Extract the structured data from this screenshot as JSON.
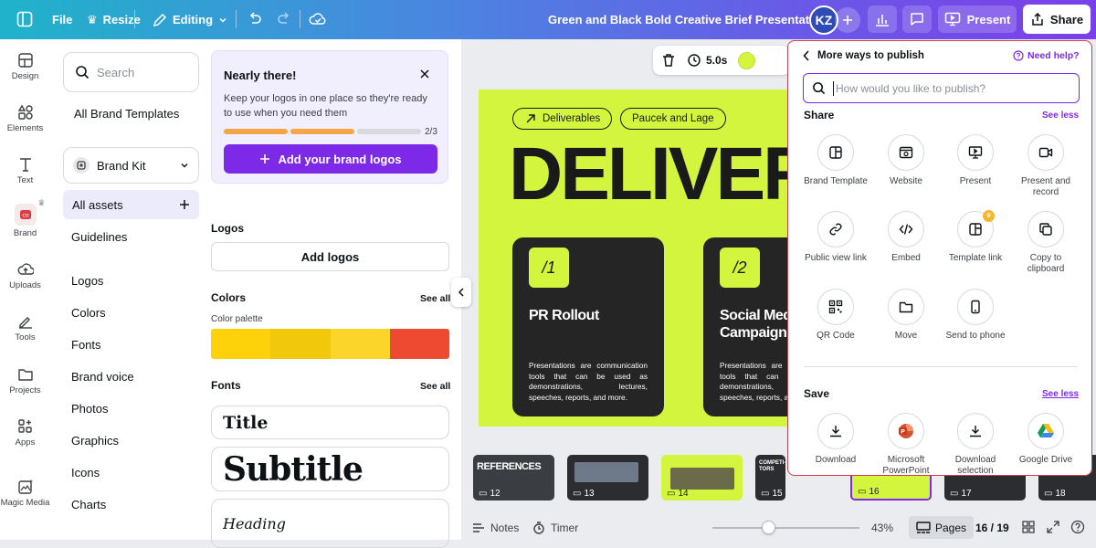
{
  "topbar": {
    "file": "File",
    "resize": "Resize",
    "editing": "Editing",
    "title": "Green and Black Bold Creative Brief Presentation",
    "avatar_initials": "KZ",
    "present": "Present",
    "share": "Share"
  },
  "rail": [
    {
      "label": "Design",
      "icon": "layout-icon"
    },
    {
      "label": "Elements",
      "icon": "shapes-icon"
    },
    {
      "label": "Text",
      "icon": "text-icon"
    },
    {
      "label": "Brand",
      "icon": "brand-icon"
    },
    {
      "label": "Uploads",
      "icon": "cloud-upload-icon"
    },
    {
      "label": "Tools",
      "icon": "pen-icon"
    },
    {
      "label": "Projects",
      "icon": "folder-icon"
    },
    {
      "label": "Apps",
      "icon": "apps-icon"
    },
    {
      "label": "Magic Media",
      "icon": "magic-media-icon"
    }
  ],
  "panel": {
    "search_placeholder": "Search",
    "all_brand_templates": "All Brand Templates",
    "brand_kit": "Brand Kit",
    "all_assets": "All assets",
    "guidelines": "Guidelines",
    "nav": [
      "Logos",
      "Colors",
      "Fonts",
      "Brand voice",
      "Photos",
      "Graphics",
      "Icons",
      "Charts"
    ],
    "nudge": {
      "title": "Nearly there!",
      "body": "Keep your logos in one place so they're ready to use when you need them",
      "progress_text": "2/3",
      "progress_completed": 2,
      "progress_total": 3,
      "button": "Add your brand logos"
    },
    "logos_title": "Logos",
    "add_logos": "Add logos",
    "colors_title": "Colors",
    "colors_see_all": "See all",
    "color_palette_label": "Color palette",
    "palette": [
      "#fdd20a",
      "#f2c80c",
      "#fbd52a",
      "#ee4a32"
    ],
    "fonts_title": "Fonts",
    "fonts_see_all": "See all",
    "font_samples": [
      "Title",
      "Subtitle",
      "Heading"
    ]
  },
  "canvas": {
    "duration": "5.0s",
    "color_swatch": "#d4f53d",
    "pills": [
      "Deliverables",
      "Paucek and Lage"
    ],
    "headline": "DELIVER",
    "cards": [
      {
        "num": "/1",
        "title": "PR Rollout",
        "body": "Presentations are communication tools that can be used as demonstrations, lectures, speeches, reports, and more."
      },
      {
        "num": "/2",
        "title": "Social Med Campaign",
        "body": "Presentations are communication tools that can be used as demonstrations, lectures, speeches, reports, and more."
      }
    ]
  },
  "pages": [
    {
      "num": "12",
      "caption": "REFERENCES"
    },
    {
      "num": "13",
      "caption": ""
    },
    {
      "num": "14",
      "caption": ""
    },
    {
      "num": "15",
      "caption": "COMPETI-TORS"
    },
    {
      "num": "16",
      "caption": ""
    },
    {
      "num": "17",
      "caption": ""
    },
    {
      "num": "18",
      "caption": ""
    }
  ],
  "bottombar": {
    "notes": "Notes",
    "timer": "Timer",
    "zoom": "43%",
    "zoom_level": 0.43,
    "pages": "Pages",
    "page_count": "16 / 19"
  },
  "publish": {
    "title": "More ways to publish",
    "need_help": "Need help?",
    "search_placeholder": "How would you like to publish?",
    "share_title": "Share",
    "share_see_less": "See less",
    "share_items": [
      {
        "label": "Brand Template",
        "icon": "brand-template-icon"
      },
      {
        "label": "Website",
        "icon": "website-icon"
      },
      {
        "label": "Present",
        "icon": "present-icon"
      },
      {
        "label": "Present and record",
        "icon": "record-icon"
      },
      {
        "label": "Public view link",
        "icon": "link-icon"
      },
      {
        "label": "Embed",
        "icon": "embed-icon"
      },
      {
        "label": "Template link",
        "icon": "template-link-icon"
      },
      {
        "label": "Copy to clipboard",
        "icon": "copy-icon"
      },
      {
        "label": "QR Code",
        "icon": "qr-code-icon"
      },
      {
        "label": "Move",
        "icon": "folder-move-icon"
      },
      {
        "label": "Send to phone",
        "icon": "phone-icon"
      }
    ],
    "save_title": "Save",
    "save_see_less": "See less",
    "save_items": [
      {
        "label": "Download",
        "icon": "download-icon"
      },
      {
        "label": "Microsoft PowerPoint",
        "icon": "powerpoint-icon"
      },
      {
        "label": "Download selection",
        "icon": "download-selection-icon"
      },
      {
        "label": "Google Drive",
        "icon": "google-drive-icon"
      }
    ]
  }
}
